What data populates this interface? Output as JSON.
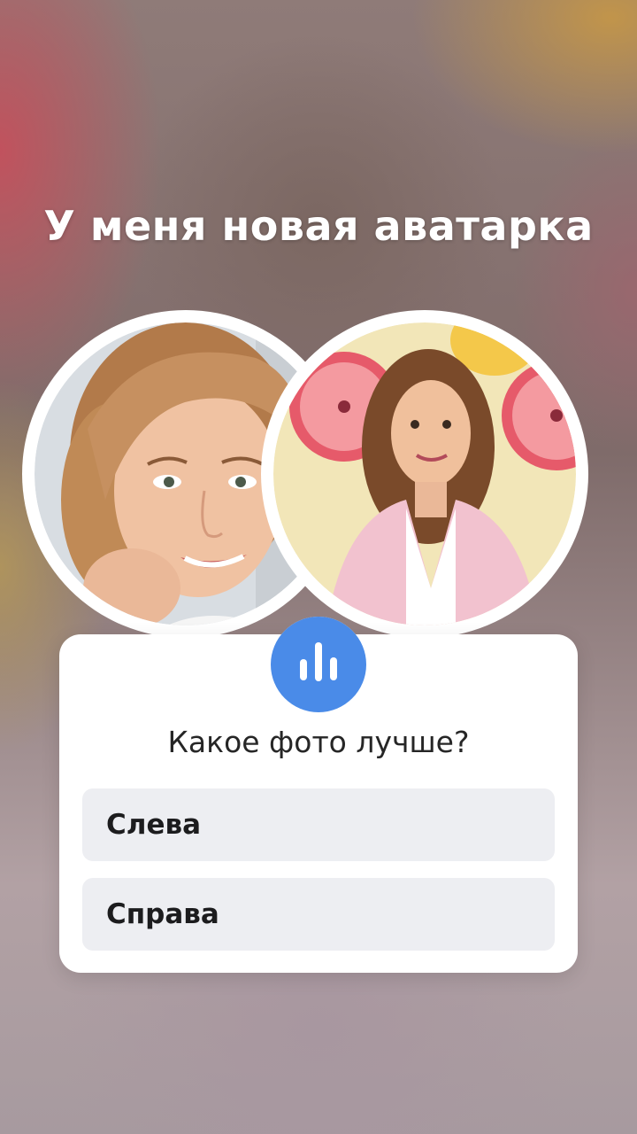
{
  "story": {
    "headline": "У меня новая аватарка"
  },
  "poll": {
    "question": "Какое фото лучше?",
    "options": [
      "Слева",
      "Справа"
    ],
    "accent_color": "#4a8be8",
    "icon": "poll-chart-icon"
  }
}
